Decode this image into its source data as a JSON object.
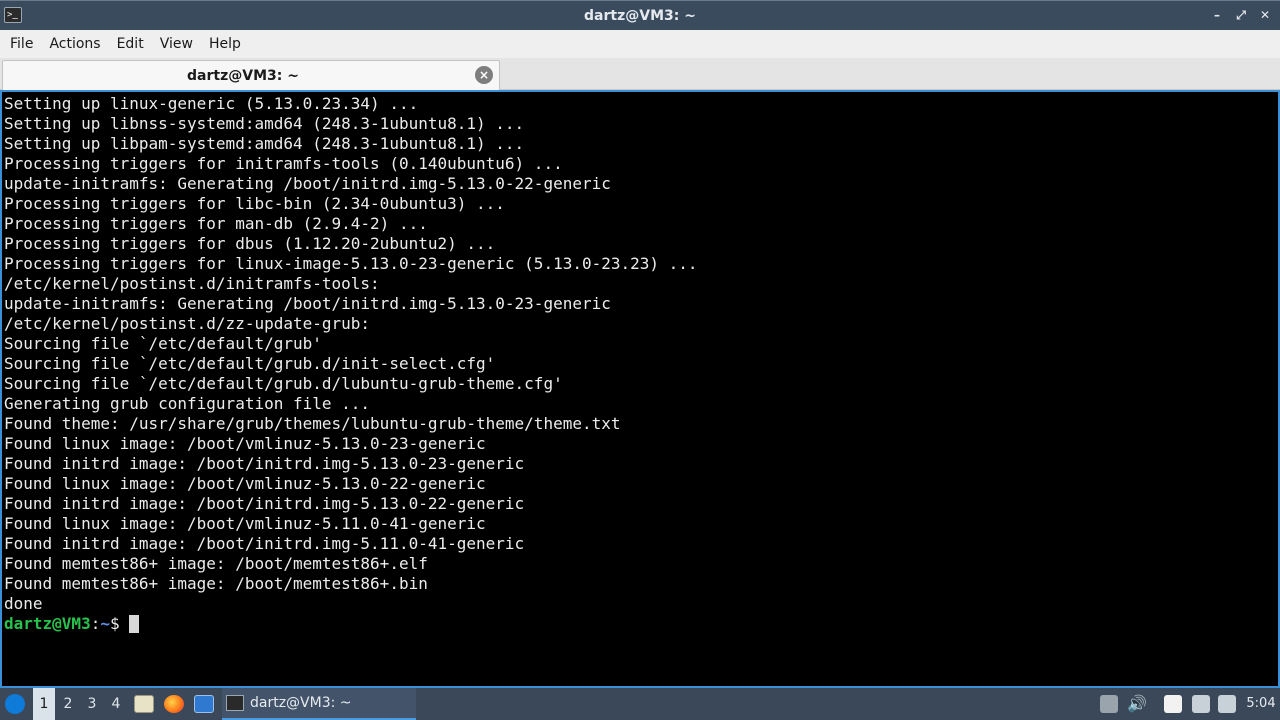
{
  "window": {
    "title": "dartz@VM3: ~",
    "app_icon": "terminal-icon",
    "buttons": [
      "minimize-icon",
      "maximize-icon",
      "close-icon"
    ]
  },
  "menu": {
    "file": "File",
    "actions": "Actions",
    "edit": "Edit",
    "view": "View",
    "help": "Help"
  },
  "tab": {
    "label": "dartz@VM3: ~",
    "close_symbol": "×"
  },
  "terminal": {
    "lines": [
      "Setting up linux-generic (5.13.0.23.34) ...",
      "Setting up libnss-systemd:amd64 (248.3-1ubuntu8.1) ...",
      "Setting up libpam-systemd:amd64 (248.3-1ubuntu8.1) ...",
      "Processing triggers for initramfs-tools (0.140ubuntu6) ...",
      "update-initramfs: Generating /boot/initrd.img-5.13.0-22-generic",
      "Processing triggers for libc-bin (2.34-0ubuntu3) ...",
      "Processing triggers for man-db (2.9.4-2) ...",
      "Processing triggers for dbus (1.12.20-2ubuntu2) ...",
      "Processing triggers for linux-image-5.13.0-23-generic (5.13.0-23.23) ...",
      "/etc/kernel/postinst.d/initramfs-tools:",
      "update-initramfs: Generating /boot/initrd.img-5.13.0-23-generic",
      "/etc/kernel/postinst.d/zz-update-grub:",
      "Sourcing file `/etc/default/grub'",
      "Sourcing file `/etc/default/grub.d/init-select.cfg'",
      "Sourcing file `/etc/default/grub.d/lubuntu-grub-theme.cfg'",
      "Generating grub configuration file ...",
      "Found theme: /usr/share/grub/themes/lubuntu-grub-theme/theme.txt",
      "Found linux image: /boot/vmlinuz-5.13.0-23-generic",
      "Found initrd image: /boot/initrd.img-5.13.0-23-generic",
      "Found linux image: /boot/vmlinuz-5.13.0-22-generic",
      "Found initrd image: /boot/initrd.img-5.13.0-22-generic",
      "Found linux image: /boot/vmlinuz-5.11.0-41-generic",
      "Found initrd image: /boot/initrd.img-5.11.0-41-generic",
      "Found memtest86+ image: /boot/memtest86+.elf",
      "Found memtest86+ image: /boot/memtest86+.bin",
      "done"
    ],
    "prompt": {
      "user_host": "dartz@VM3",
      "colon": ":",
      "path": "~",
      "symbol": "$ "
    }
  },
  "taskbar": {
    "start_icon": "lubuntu-start-icon",
    "workspaces": [
      "1",
      "2",
      "3",
      "4"
    ],
    "active_workspace": "1",
    "quicklaunch": [
      "file-manager-icon",
      "firefox-icon",
      "show-desktop-icon"
    ],
    "task_label": "dartz@VM3: ~",
    "tray": [
      "update-notifier-icon",
      "volume-icon",
      "clipboard-icon",
      "network-icon",
      "notification-icon"
    ],
    "clock": "5:04"
  },
  "colors": {
    "accent": "#3a8fd6",
    "prompt_user": "#27c24c",
    "prompt_path": "#5a8fe6"
  }
}
